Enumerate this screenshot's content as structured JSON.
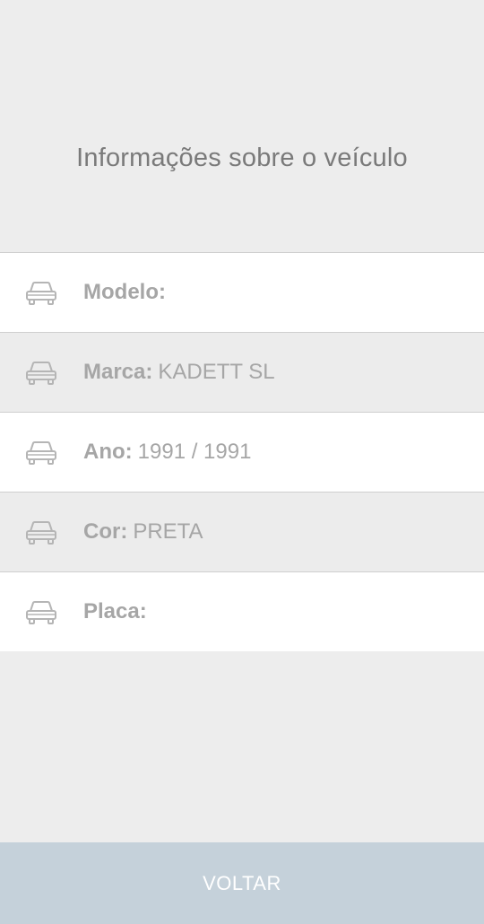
{
  "header": {
    "title": "Informações sobre o veículo"
  },
  "vehicle_info": {
    "items": [
      {
        "label": "Modelo:",
        "value": "",
        "icon": "car-icon"
      },
      {
        "label": "Marca:",
        "value": "KADETT SL",
        "icon": "car-icon"
      },
      {
        "label": "Ano:",
        "value": "1991 / 1991",
        "icon": "car-icon"
      },
      {
        "label": "Cor:",
        "value": "PRETA",
        "icon": "car-icon"
      },
      {
        "label": "Placa:",
        "value": "",
        "icon": "car-icon"
      }
    ]
  },
  "footer": {
    "back_label": "VOLTAR"
  },
  "colors": {
    "background": "#ededed",
    "row_white": "#ffffff",
    "row_gray": "#ececec",
    "text_gray": "#a6a6a6",
    "title_gray": "#7a7a7a",
    "button_bg": "#c5d1da",
    "button_text": "#ffffff"
  }
}
